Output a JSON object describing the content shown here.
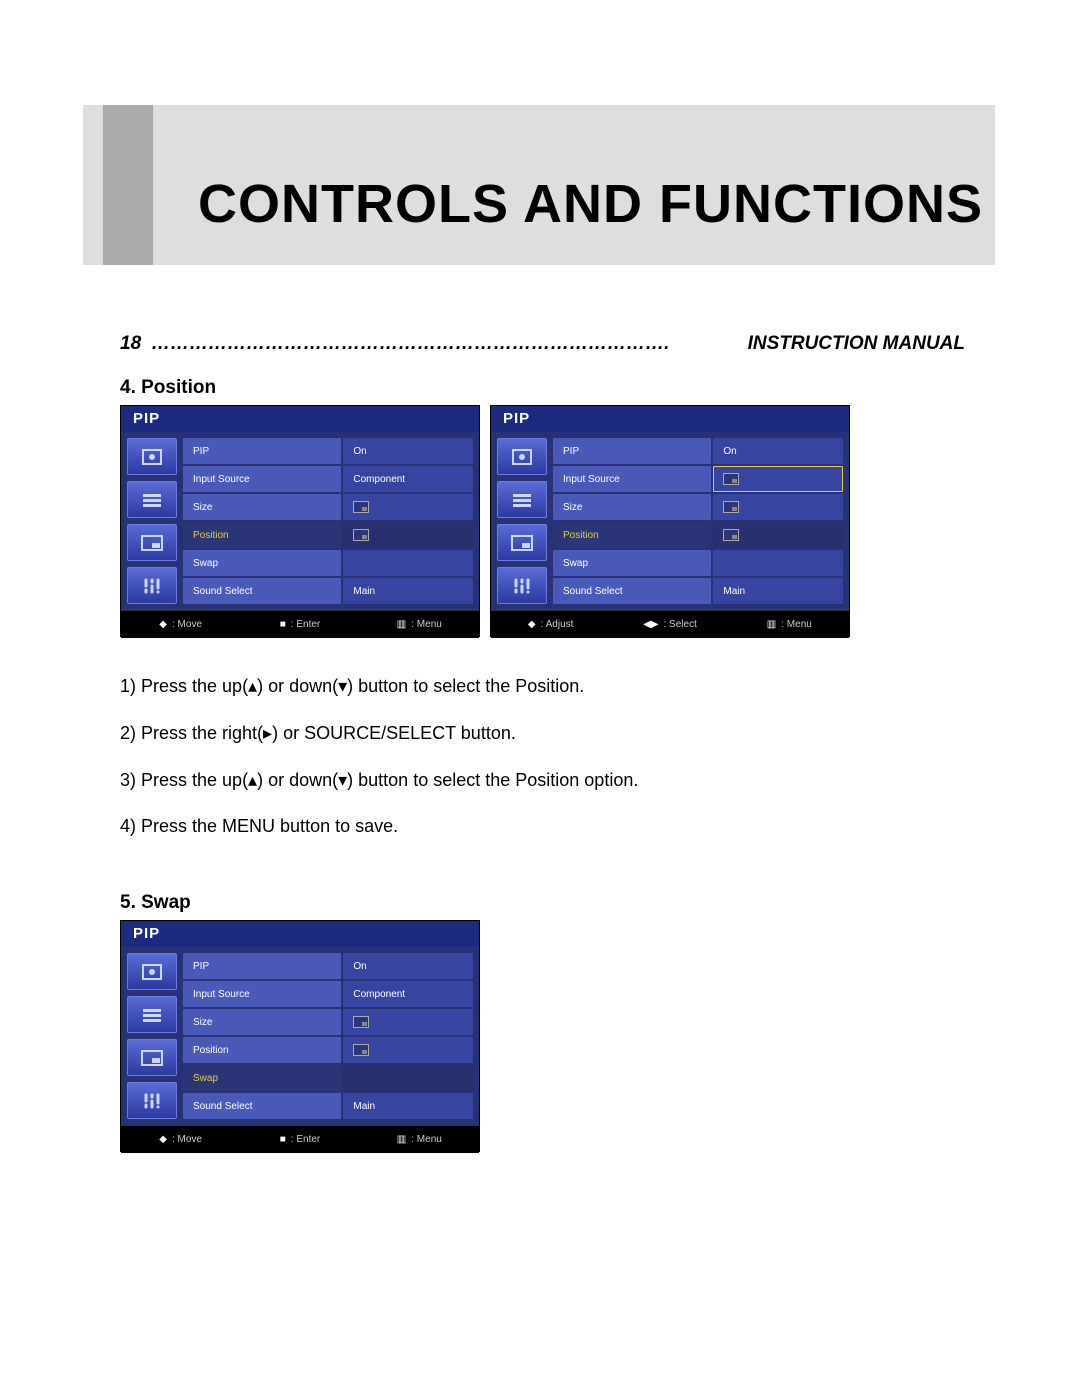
{
  "banner": {
    "title": "CONTROLS AND FUNCTIONS"
  },
  "header": {
    "page_num": "18",
    "leader": "……………………………………………………………………….",
    "manual": "INSTRUCTION MANUAL"
  },
  "section_position": {
    "heading": "4. Position",
    "steps": [
      "1) Press the up(▴) or down(▾) button to select the Position.",
      "2) Press the right(▸) or SOURCE/SELECT button.",
      "3) Press the up(▴) or down(▾) button to select the Position option.",
      "4) Press the MENU button to save."
    ]
  },
  "section_swap": {
    "heading": "5. Swap"
  },
  "osd_common": {
    "title": "PIP",
    "rows": {
      "pip": "PIP",
      "input_source": "Input Source",
      "size": "Size",
      "position": "Position",
      "swap": "Swap",
      "sound_select": "Sound Select"
    },
    "values": {
      "on": "On",
      "component": "Component",
      "main": "Main"
    }
  },
  "screen_left": {
    "highlight": "position",
    "vals": {
      "pip": "On",
      "input_source": "Component",
      "size": "icon",
      "position": "icon",
      "swap": "",
      "sound_select": "Main"
    },
    "footer": {
      "a_icon": "◆",
      "a": ": Move",
      "b_icon": "■",
      "b": ": Enter",
      "c_icon": "▥",
      "c": ": Menu"
    }
  },
  "screen_right": {
    "highlight": "position",
    "focus": "input_source",
    "vals": {
      "pip": "On",
      "input_source": "icon",
      "size": "icon",
      "position": "icon",
      "swap": "",
      "sound_select": "Main"
    },
    "footer": {
      "a_icon": "◆",
      "a": ": Adjust",
      "b_icon": "◀▶",
      "b": ": Select",
      "c_icon": "▥",
      "c": ": Menu"
    }
  },
  "screen_swap": {
    "highlight": "swap",
    "vals": {
      "pip": "On",
      "input_source": "Component",
      "size": "icon",
      "position": "icon",
      "swap": "",
      "sound_select": "Main"
    },
    "footer": {
      "a_icon": "◆",
      "a": ": Move",
      "b_icon": "■",
      "b": ": Enter",
      "c_icon": "▥",
      "c": ": Menu"
    }
  }
}
